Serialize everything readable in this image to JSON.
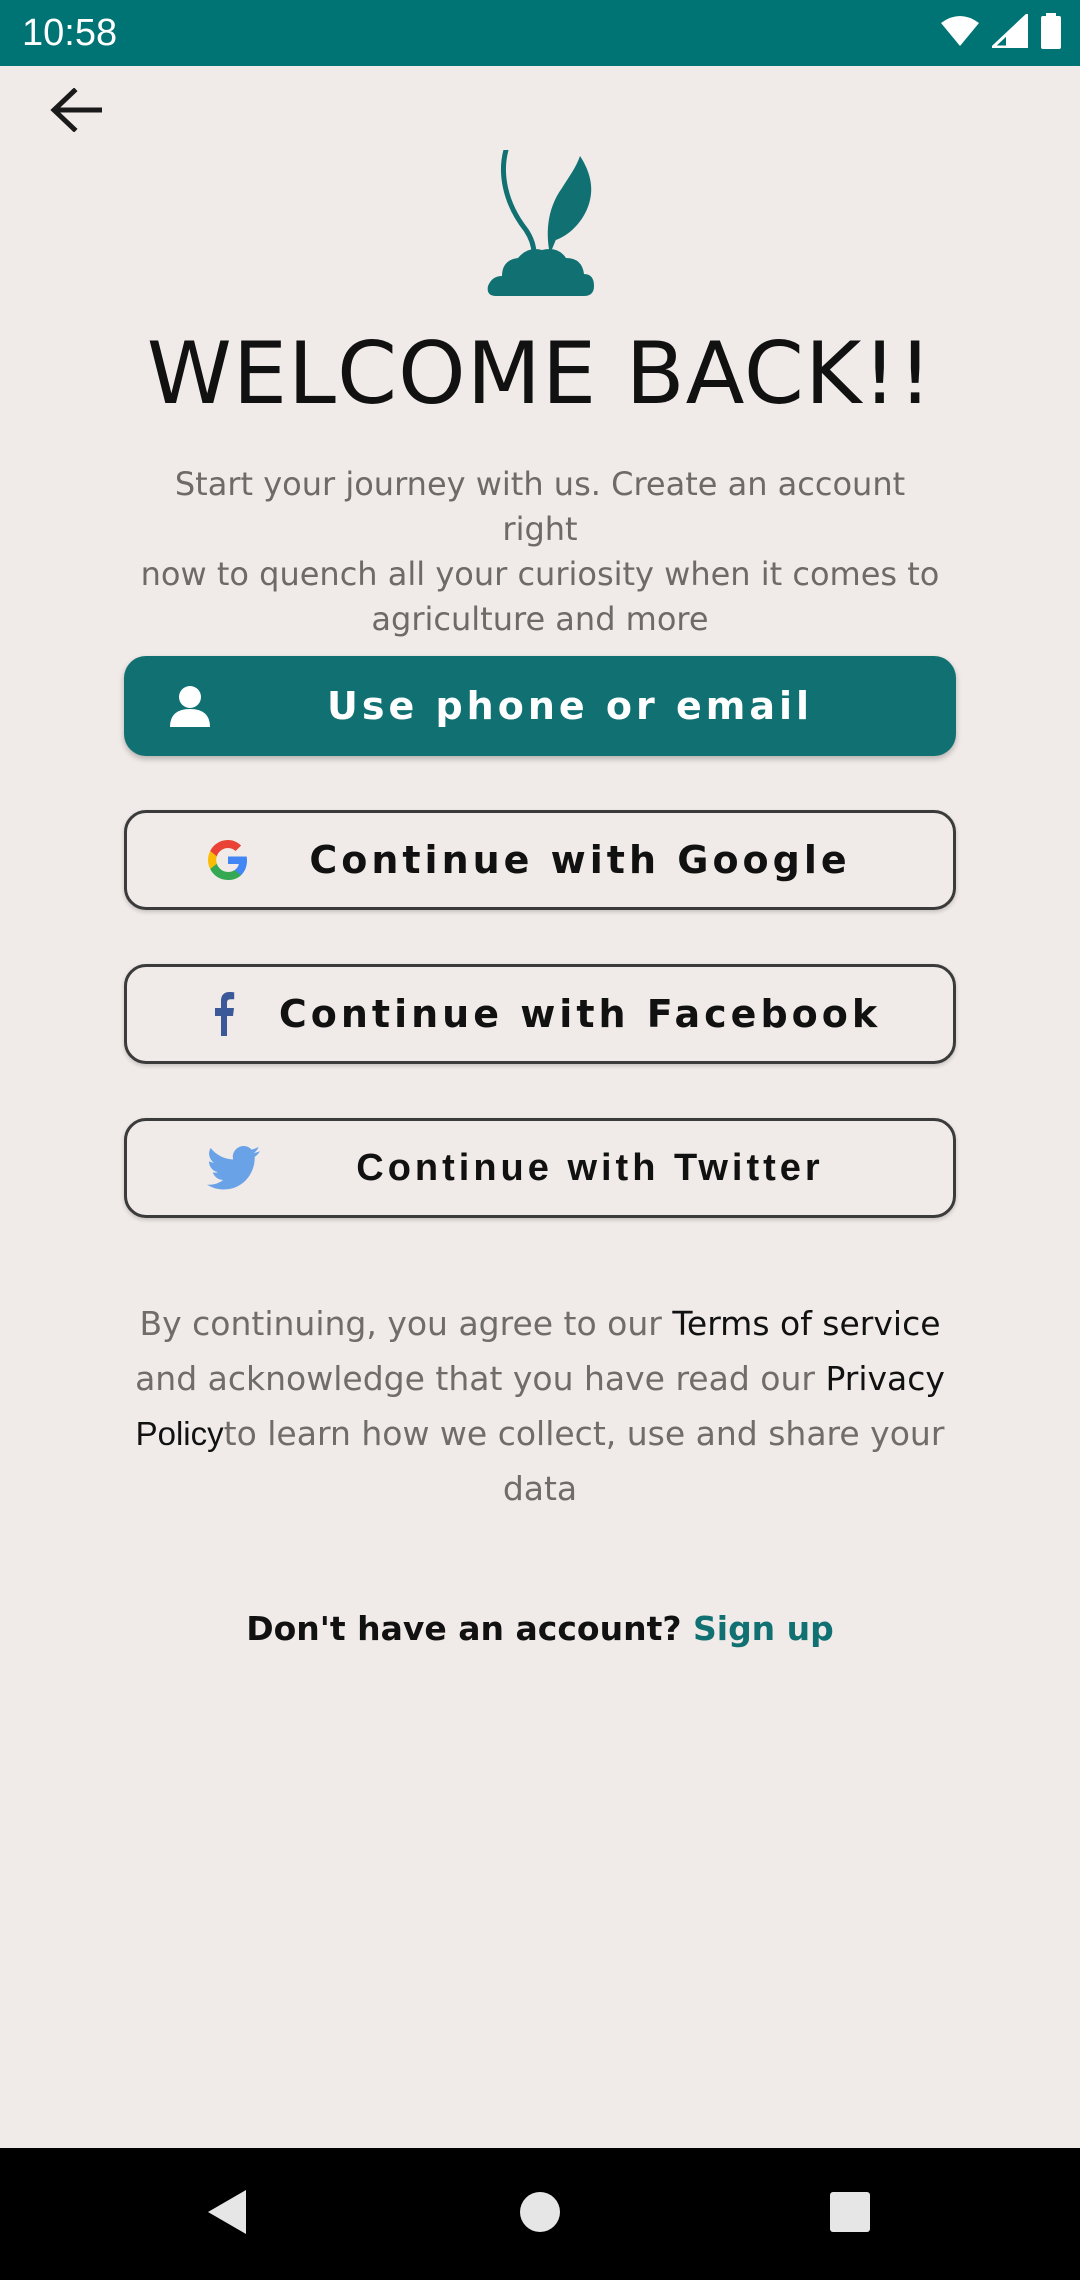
{
  "status_bar": {
    "time": "10:58"
  },
  "header": {
    "back_icon": "arrow-left-icon"
  },
  "logo": {
    "icon": "plant-sprout-logo",
    "color": "#117172"
  },
  "welcome": {
    "title": "WELCOME BACK!!",
    "subtitle_lines": [
      "Start your journey with us. Create an account right",
      "now to quench all your curiosity when it comes to",
      "agriculture and more"
    ]
  },
  "buttons": {
    "phone_email": {
      "label": "Use phone or email",
      "icon": "person-icon"
    },
    "google": {
      "label": "Continue with Google",
      "icon": "google-icon"
    },
    "facebook": {
      "label": "Continue with Facebook",
      "icon": "facebook-icon"
    },
    "twitter": {
      "label": "Continue with Twitter",
      "icon": "twitter-icon"
    }
  },
  "terms": {
    "prefix": "By continuing, you agree to our ",
    "terms_link": "Terms of service",
    "middle": " and acknowledge that you have read our ",
    "privacy_word1": "Privacy",
    "privacy_word2": "Policy",
    "suffix": "to learn how we collect, use and share your data"
  },
  "signup": {
    "prompt": "Don't have an account? ",
    "link": "Sign up"
  },
  "colors": {
    "accent": "#117172",
    "status_bar": "#007374",
    "background": "#f0ebe8"
  }
}
